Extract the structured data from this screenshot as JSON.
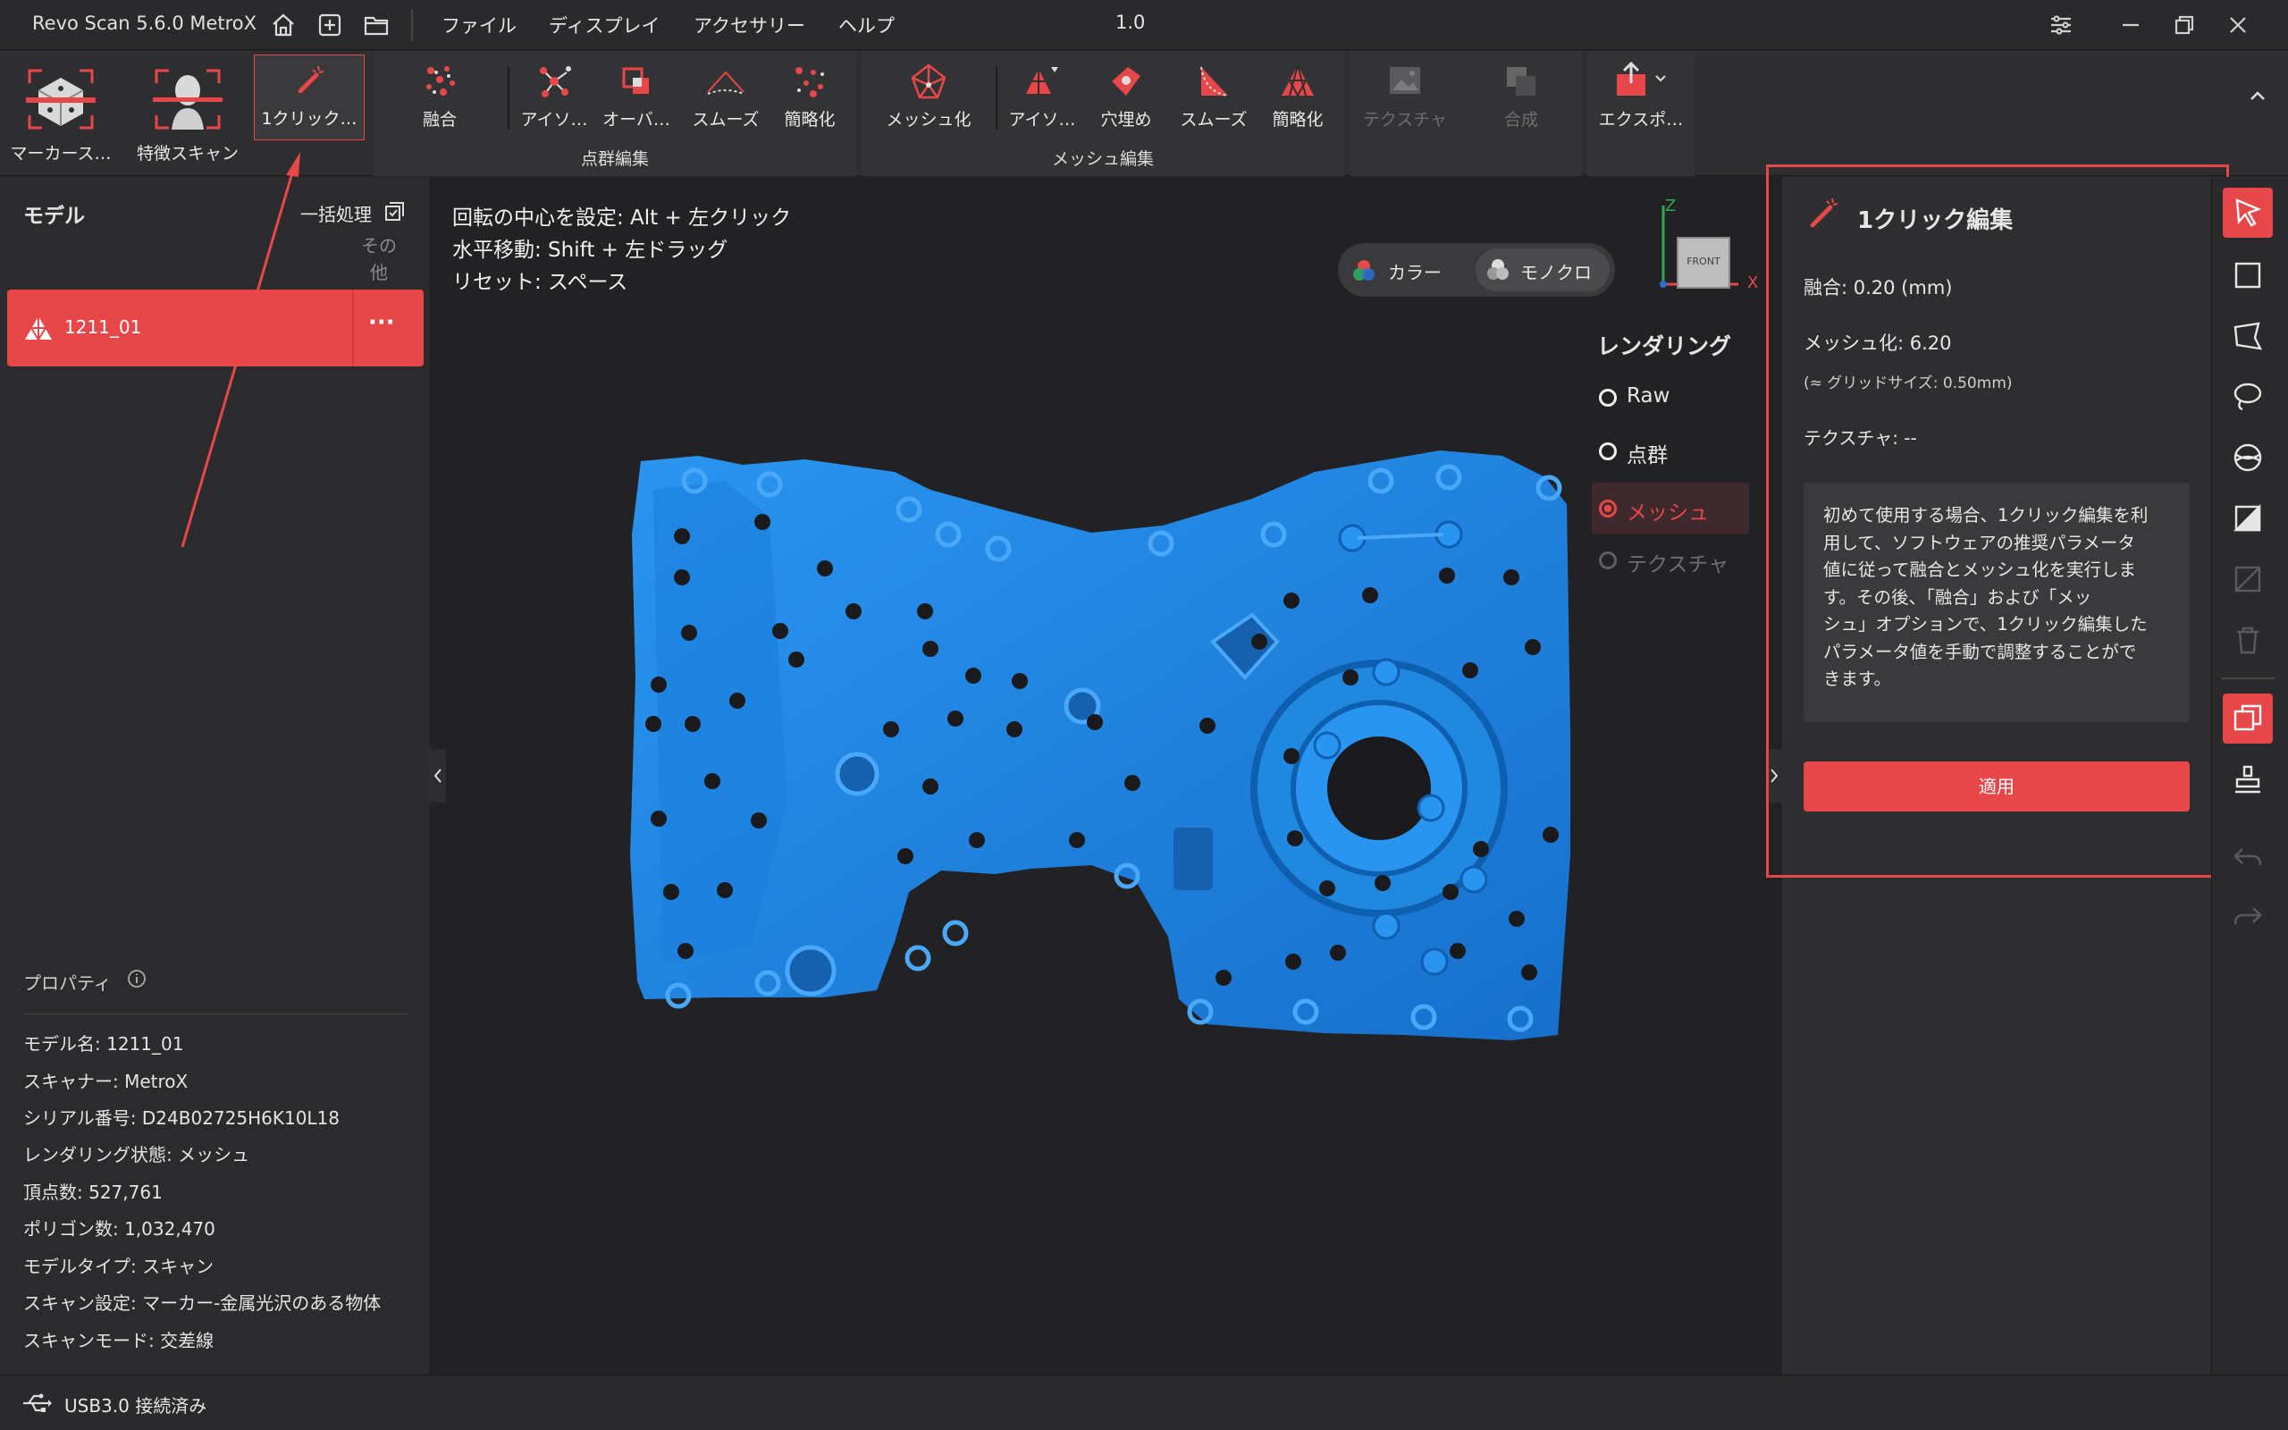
{
  "titlebar": {
    "app_name": "Revo Scan 5.6.0 MetroX",
    "menus": [
      "ファイル",
      "ディスプレイ",
      "アクセサリー",
      "ヘルプ"
    ],
    "center_value": "1.0"
  },
  "ribbon": {
    "marker_scan": "マーカース…",
    "feature_scan": "特徴スキャン",
    "one_click": "1クリック…",
    "pc_fuse": "融合",
    "pc_isolate": "アイソ…",
    "pc_overlap": "オーバ…",
    "pc_smooth": "スムーズ",
    "pc_simplify": "簡略化",
    "pc_group": "点群編集",
    "mesh_make": "メッシュ化",
    "mesh_isolate": "アイソ…",
    "mesh_fill": "穴埋め",
    "mesh_smooth": "スムーズ",
    "mesh_simplify": "簡略化",
    "mesh_group": "メッシュ編集",
    "texture": "テクスチャ",
    "merge": "合成",
    "export": "エクスポ…"
  },
  "left": {
    "title": "モデル",
    "batch": "一括処理",
    "other": "その他",
    "model_name": "1211_01",
    "more": "···",
    "properties_title": "プロパティ",
    "props": [
      "モデル名:  1211_01",
      "スキャナー:  MetroX",
      "シリアル番号:  D24B02725H6K10L18",
      "レンダリング状態:  メッシュ",
      "頂点数:  527,761",
      "ポリゴン数:  1,032,470",
      "モデルタイプ:  スキャン",
      "スキャン設定:  マーカー-金属光沢のある物体",
      "スキャンモード:  交差線"
    ]
  },
  "viewport": {
    "hint1": "回転の中心を設定: Alt + 左クリック",
    "hint2": "水平移動: Shift + 左ドラッグ",
    "hint3": "リセット: スペース",
    "color_label": "カラー",
    "mono_label": "モノクロ",
    "axis_z": "Z",
    "axis_x": "X",
    "cube_face": "FRONT",
    "render_title": "レンダリング",
    "render_options": [
      "Raw",
      "点群",
      "メッシュ",
      "テクスチャ"
    ],
    "render_selected": "メッシュ"
  },
  "panel": {
    "title": "1クリック編集",
    "fuse": "融合:  0.20 (mm)",
    "mesh": "メッシュ化:  6.20",
    "grid": "(≈ グリッドサイズ: 0.50mm)",
    "texture": "テクスチャ: --",
    "info_lines": [
      "初めて使用する場合、1クリック編集を利",
      "用して、ソフトウェアの推奨パラメータ",
      "値に従って融合とメッシュ化を実行しま",
      "す。その後、「融合」および「メッ",
      "シュ」オプションで、1クリック編集した",
      "パラメータ値を手動で調整することがで",
      "きます。"
    ],
    "apply": "適用"
  },
  "status": {
    "usb": "USB3.0 接続済み"
  },
  "colors": {
    "accent": "#e8474a",
    "mesh_blue": "#1e8ae6",
    "panel_bg": "#2e2e30"
  }
}
